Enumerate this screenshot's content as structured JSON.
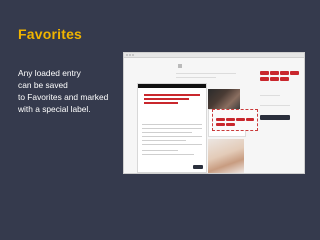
{
  "slide": {
    "title": "Favorites",
    "description_lines": [
      "Any loaded entry",
      "can be saved",
      "to Favorites and marked",
      "with a special label."
    ],
    "accent_color": "#f0b400",
    "background_color": "#353a4d"
  }
}
